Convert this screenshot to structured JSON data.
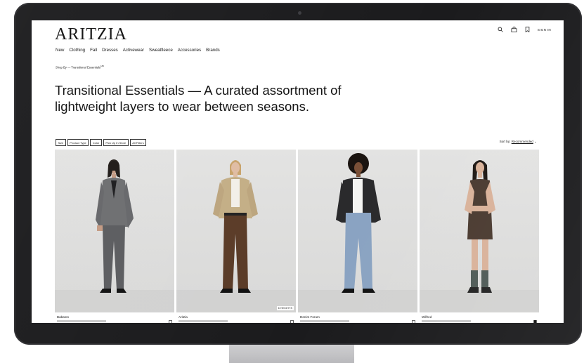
{
  "brand": {
    "logo": "ARITZIA"
  },
  "nav": {
    "items": [
      "New",
      "Clothing",
      "Fall",
      "Dresses",
      "Activewear",
      "Sweatfleece",
      "Accessories",
      "Brands"
    ]
  },
  "header": {
    "sign_in": "SIGN IN",
    "icons": [
      "search-icon",
      "bag-icon",
      "bookmark-icon"
    ]
  },
  "breadcrumb": {
    "text": "Shop By — Transitional Essentials",
    "count": "180"
  },
  "page": {
    "headline": "Transitional Essentials — A curated assortment of lightweight layers to wear between seasons."
  },
  "filters": {
    "buttons": [
      "Size",
      "Product Type",
      "Color",
      "Pick Up In Store",
      "All Filters"
    ]
  },
  "sort": {
    "label": "Sort by:",
    "value": "Recommended"
  },
  "products": [
    {
      "brand": "Babaton",
      "bookmarked": false
    },
    {
      "brand": "Aritzia",
      "bookmarked": false,
      "badge": "6 HEIGHTS"
    },
    {
      "brand": "Denim Forum",
      "bookmarked": false
    },
    {
      "brand": "Wilfred",
      "bookmarked": true
    }
  ],
  "colors": {
    "bezel": "#1b1b1d",
    "photo_bg": "#dededd",
    "text": "#111111"
  }
}
